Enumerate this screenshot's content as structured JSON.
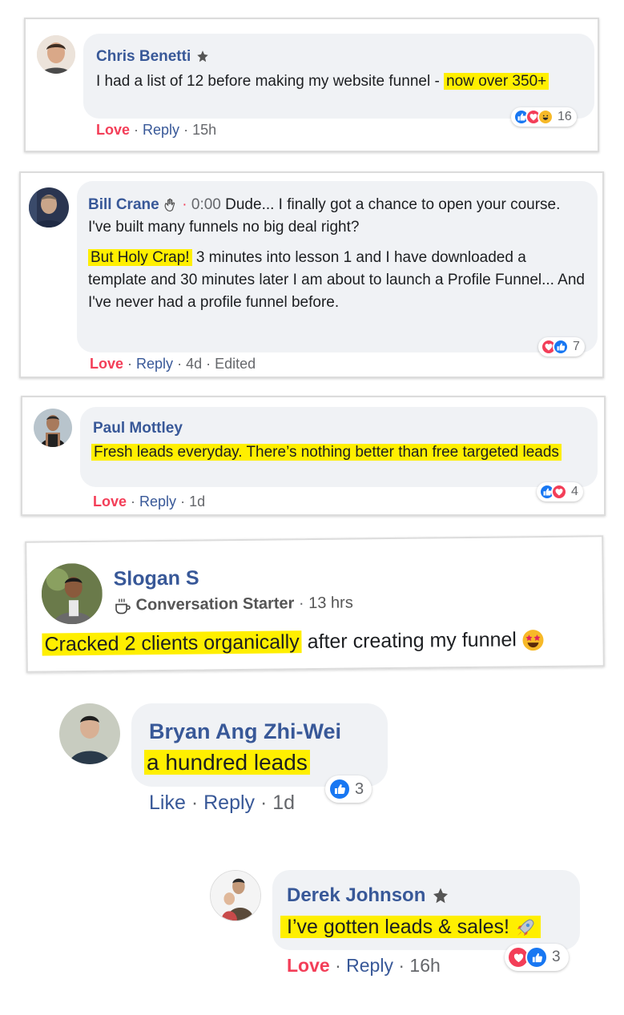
{
  "comments": [
    {
      "name": "Chris Benetti",
      "text_pre": "I had a list of 12 before making my website funnel - ",
      "text_hl": "now over 350+",
      "actions": {
        "love": "Love",
        "reply": "Reply",
        "time": "15h"
      },
      "reaction_count": "16"
    },
    {
      "name": "Bill Crane",
      "audio_time": "0:00",
      "text_line1": "Dude... I finally got a chance to open your course. I've built many funnels no big deal right?",
      "text_hl": "But Holy Crap!",
      "text_rest": " 3 minutes into lesson 1 and I have downloaded a template and 30 minutes later I am about to launch a Profile Funnel... And I've never had a profile funnel before.",
      "actions": {
        "love": "Love",
        "reply": "Reply",
        "time": "4d",
        "edited": "Edited"
      },
      "reaction_count": "7"
    },
    {
      "name": "Paul Mottley",
      "text_hl": "Fresh leads everyday. There’s nothing better than free targeted leads",
      "actions": {
        "love": "Love",
        "reply": "Reply",
        "time": "1d"
      },
      "reaction_count": "4"
    },
    {
      "name": "Slogan S",
      "badge": "Conversation Starter",
      "time": "13 hrs",
      "text_hl": "Cracked 2 clients organically",
      "text_rest": " after creating my funnel"
    },
    {
      "name": "Bryan Ang Zhi-Wei",
      "text_hl": "a hundred leads",
      "actions": {
        "like": "Like",
        "reply": "Reply",
        "time": "1d"
      },
      "reaction_count": "3"
    },
    {
      "name": "Derek Johnson",
      "text_hl": "I’ve gotten leads & sales!",
      "actions": {
        "love": "Love",
        "reply": "Reply",
        "time": "16h"
      },
      "reaction_count": "3"
    }
  ],
  "colors": {
    "name": "#385898",
    "highlight": "#ffef00",
    "love": "#f33e58",
    "like": "#1877f2",
    "bubble": "#f0f2f5"
  }
}
